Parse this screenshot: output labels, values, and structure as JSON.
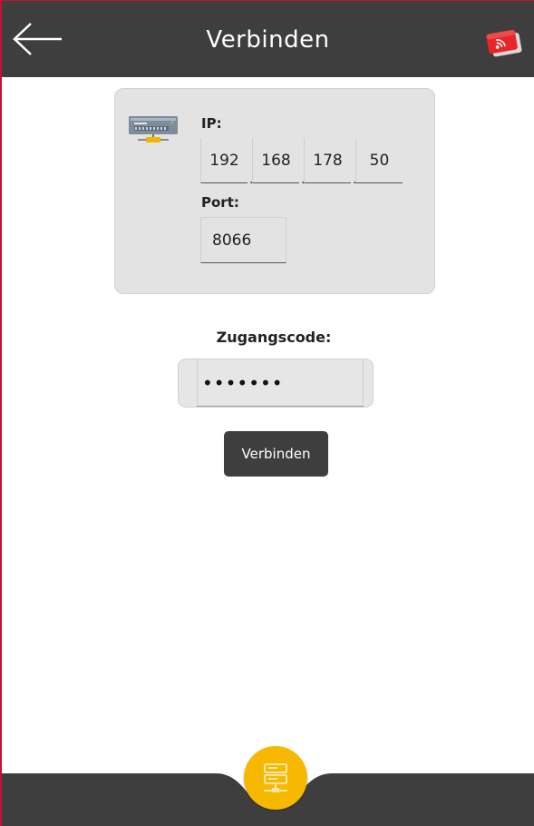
{
  "header": {
    "title": "Verbinden",
    "back_icon": "arrow-left-icon",
    "cast_icon": "cast-screen-icon"
  },
  "server": {
    "icon": "server-network-icon",
    "ip_label": "IP:",
    "ip": [
      "192",
      "168",
      "178",
      "50"
    ],
    "ip_separator": ".",
    "port_label": "Port:",
    "port": "8066"
  },
  "access": {
    "label": "Zugangscode:",
    "value_masked": "•••••••"
  },
  "actions": {
    "connect_label": "Verbinden"
  },
  "bottom_nav": {
    "center_icon": "server-icon"
  },
  "colors": {
    "header_bg": "#3e3e3e",
    "accent_red": "#c8102e",
    "fab_yellow": "#f6b800",
    "card_bg": "#e3e3e3"
  }
}
